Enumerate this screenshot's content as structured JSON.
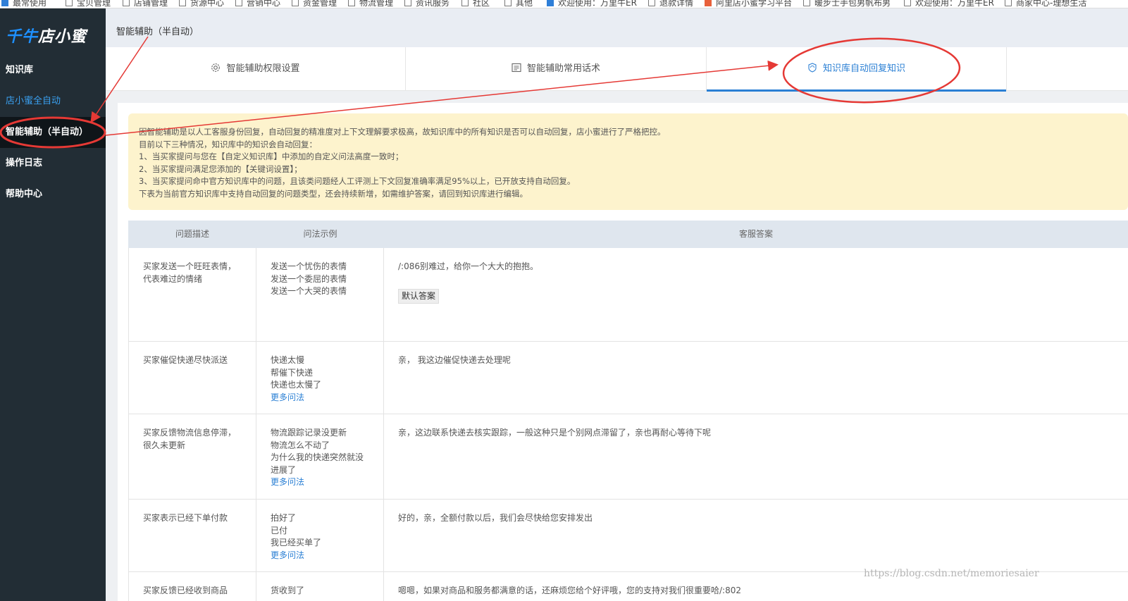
{
  "bookmarks": [
    {
      "label": "最常使用",
      "icon": "checkbox-icon"
    },
    {
      "label": "宝贝管理",
      "icon": "folder-icon"
    },
    {
      "label": "店铺管理",
      "icon": "folder-icon"
    },
    {
      "label": "货源中心",
      "icon": "folder-icon"
    },
    {
      "label": "营销中心",
      "icon": "folder-icon"
    },
    {
      "label": "资金管理",
      "icon": "folder-icon"
    },
    {
      "label": "物流管理",
      "icon": "folder-icon"
    },
    {
      "label": "资讯服务",
      "icon": "folder-icon"
    },
    {
      "label": "社区",
      "icon": "folder-icon"
    },
    {
      "label": "其他",
      "icon": "folder-icon"
    },
    {
      "label": "欢迎使用：万里牛ER",
      "icon": "h-logo-icon"
    },
    {
      "label": "退款详情",
      "icon": "page-icon"
    },
    {
      "label": "阿里店小蜜学习平台",
      "icon": "ali-logo-icon"
    },
    {
      "label": "暖步士手包男帆布男",
      "icon": "page-icon"
    },
    {
      "label": "欢迎使用：万里牛ER",
      "icon": "page-icon"
    },
    {
      "label": "商家中心-理想生活",
      "icon": "page-icon"
    }
  ],
  "sidebar": {
    "logo_main": "千牛",
    "logo_sub": "店小蜜",
    "items": [
      {
        "label": "知识库"
      },
      {
        "label": "店小蜜全自动"
      },
      {
        "label": "智能辅助（半自动）"
      },
      {
        "label": "操作日志"
      },
      {
        "label": "帮助中心"
      }
    ]
  },
  "header": {
    "title": "智能辅助（半自动）"
  },
  "tabs": [
    {
      "label": "智能辅助权限设置",
      "icon": "gear-icon"
    },
    {
      "label": "智能辅助常用话术",
      "icon": "message-icon"
    },
    {
      "label": "知识库自动回复知识",
      "icon": "refresh-icon"
    }
  ],
  "notice": {
    "lines": [
      "因智能辅助是以人工客服身份回复，自动回复的精准度对上下文理解要求极高，故知识库中的所有知识是否可以自动回复，店小蜜进行了严格把控。",
      "目前以下三种情况，知识库中的知识会自动回复：",
      "1、当买家提问与您在【自定义知识库】中添加的自定义问法高度一致时；",
      "2、当买家提问满足您添加的【关键词设置】；",
      "3、当买家提问命中官方知识库中的问题，且该类问题经人工评测上下文回复准确率满足95%以上，已开放支持自动回复。",
      "下表为当前官方知识库中支持自动回复的问题类型，还会持续新增，如需维护答案，请回到知识库进行编辑。"
    ]
  },
  "table": {
    "headers": [
      "问题描述",
      "问法示例",
      "客服答案"
    ],
    "rows": [
      {
        "desc": "买家发送一个旺旺表情，代表难过的情绪",
        "examples": [
          "发送一个忧伤的表情",
          "发送一个委屈的表情",
          "发送一个大哭的表情"
        ],
        "more": "",
        "answer": "/:086别难过，给你一个大大的抱抱。",
        "badge": "默认答案"
      },
      {
        "desc": "买家催促快递尽快派送",
        "examples": [
          "快递太慢",
          "帮催下快递",
          "快递也太慢了"
        ],
        "more": "更多问法",
        "answer": "亲， 我这边催促快递去处理呢",
        "badge": ""
      },
      {
        "desc": "买家反馈物流信息停滞，很久未更新",
        "examples": [
          "物流跟踪记录没更新",
          "物流怎么不动了",
          "为什么我的快递突然就没进展了"
        ],
        "more": "更多问法",
        "answer": "亲，这边联系快递去核实跟踪，一般这种只是个别网点滞留了，亲也再耐心等待下呢",
        "badge": ""
      },
      {
        "desc": "买家表示已经下单付款",
        "examples": [
          "拍好了",
          "已付",
          "我已经买单了"
        ],
        "more": "更多问法",
        "answer": "好的，亲，全额付款以后，我们会尽快给您安排发出",
        "badge": ""
      },
      {
        "desc": "买家反馈已经收到商品",
        "examples": [
          "货收到了"
        ],
        "more": "",
        "answer": "嗯嗯，如果对商品和服务都满意的话，还麻烦您给个好评哦，您的支持对我们很重要哈/:802",
        "badge": ""
      }
    ]
  },
  "watermark": "https://blog.csdn.net/memoriesaier",
  "colors": {
    "accent": "#2a7fd4",
    "annotation": "#e53935",
    "sidebar_bg": "#222d35",
    "notice_bg": "#fdf3cd"
  }
}
